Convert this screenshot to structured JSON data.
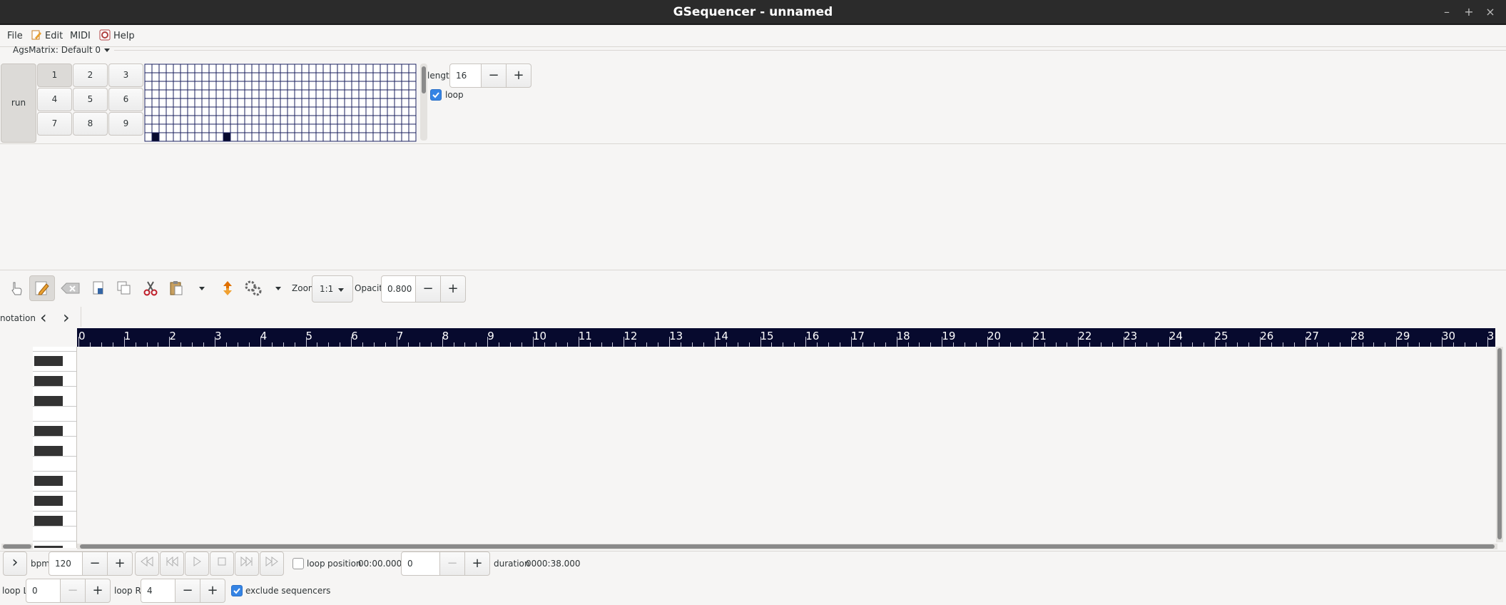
{
  "window": {
    "title": "GSequencer - unnamed",
    "minimize": "–",
    "maximize": "+",
    "close": "×"
  },
  "menubar": {
    "file": "File",
    "edit": "Edit",
    "midi": "MIDI",
    "help": "Help"
  },
  "machine": {
    "name": "AgsMatrix: Default 0",
    "run_label": "run",
    "pads": [
      "1",
      "2",
      "3",
      "4",
      "5",
      "6",
      "7",
      "8",
      "9"
    ],
    "grid_cols": 38,
    "grid_rows": 9,
    "active_cells": [
      1,
      11
    ],
    "length_label": "length",
    "length_value": "16",
    "loop_label": "loop",
    "loop_checked": true
  },
  "toolbar": {
    "zoom_label": "Zoom",
    "zoom_value": "1:1",
    "opacity_label": "Opacity",
    "opacity_value": "0.800",
    "minus": "−",
    "plus": "+"
  },
  "notation": {
    "label": "notation",
    "prev": "‹",
    "next": "›",
    "ruler_ticks": [
      "0",
      "1",
      "2",
      "3",
      "4",
      "5",
      "6",
      "7",
      "8",
      "9",
      "10",
      "11",
      "12",
      "13",
      "14",
      "15",
      "16",
      "17",
      "18",
      "19",
      "20",
      "21",
      "22",
      "23",
      "24",
      "25",
      "26",
      "27",
      "28",
      "29",
      "30",
      "3"
    ]
  },
  "transport": {
    "bpm_label": "bpm",
    "bpm_value": "120",
    "loop_label": "loop",
    "loop_checked": false,
    "position_label": "position",
    "position_value": "00:00.000",
    "position_entry": "0",
    "duration_label": "duration",
    "duration_value": "0000:38.000",
    "loop_l_label": "loop L",
    "loop_l_value": "0",
    "loop_r_label": "loop R",
    "loop_r_value": "4",
    "exclude_label": "exclude sequencers",
    "exclude_checked": true,
    "expand": "›"
  },
  "colors": {
    "ruler_bg": "#070a2e",
    "grid_line": "#1a1f5c",
    "accent": "#3584e4"
  }
}
